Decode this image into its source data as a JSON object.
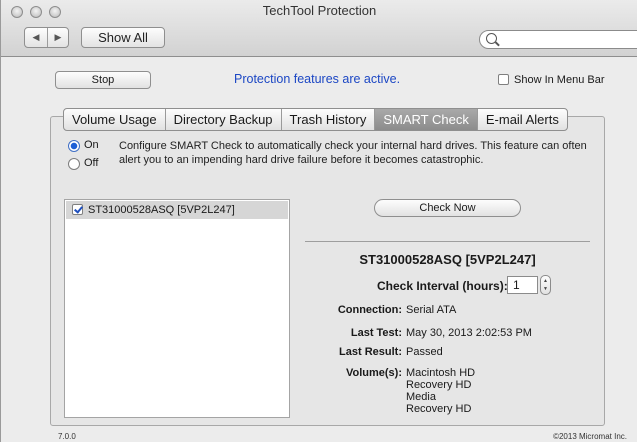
{
  "window": {
    "title": "TechTool Protection"
  },
  "toolbar": {
    "back": "◀",
    "forward": "▶",
    "show_all": "Show All",
    "search_placeholder": ""
  },
  "top": {
    "stop_label": "Stop",
    "status": "Protection features are active.",
    "show_in_menu_bar": "Show In Menu Bar",
    "accent_color": "#1c47c4"
  },
  "tabs": [
    {
      "label": "Volume Usage",
      "selected": false
    },
    {
      "label": "Directory Backup",
      "selected": false
    },
    {
      "label": "Trash History",
      "selected": false
    },
    {
      "label": "SMART Check",
      "selected": true
    },
    {
      "label": "E-mail Alerts",
      "selected": false
    }
  ],
  "smart": {
    "on_label": "On",
    "off_label": "Off",
    "selected": "On",
    "description": "Configure SMART Check to automatically check your internal hard drives. This feature can often alert you to an impending hard drive failure before it becomes catastrophic.",
    "drives": [
      {
        "name": "ST31000528ASQ [5VP2L247]",
        "checked": true
      }
    ],
    "check_now": "Check Now",
    "detail": {
      "title": "ST31000528ASQ [5VP2L247]",
      "interval_label": "Check Interval (hours):",
      "interval_value": "1",
      "connection_label": "Connection:",
      "connection": "Serial ATA",
      "last_test_label": "Last Test:",
      "last_test": "May 30, 2013 2:02:53 PM",
      "last_result_label": "Last Result:",
      "last_result": "Passed",
      "volumes_label": "Volume(s):",
      "volumes": [
        "Macintosh HD",
        "Recovery HD",
        "Media",
        "Recovery HD"
      ]
    }
  },
  "footer": {
    "version": "7.0.0",
    "copyright": "©2013 Micromat Inc."
  }
}
